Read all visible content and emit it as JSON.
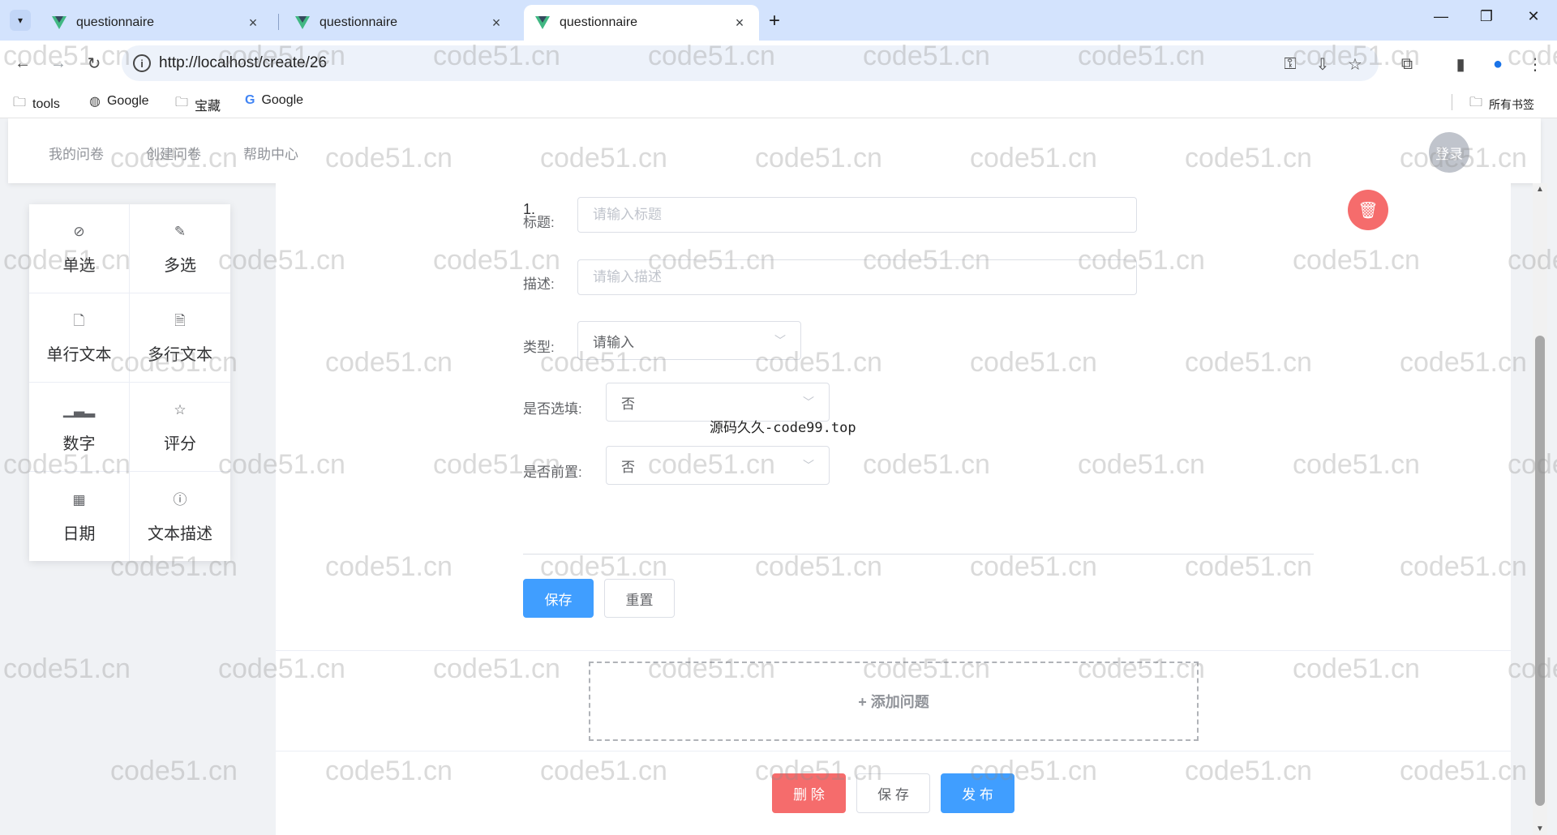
{
  "browser": {
    "tabs": [
      {
        "title": "questionnaire",
        "active": false
      },
      {
        "title": "questionnaire",
        "active": false
      },
      {
        "title": "questionnaire",
        "active": true
      }
    ],
    "new_tab_label": "+",
    "url": "http://localhost/create/26",
    "bookmarks": [
      {
        "label": "tools",
        "icon": "folder-icon"
      },
      {
        "label": "Google",
        "icon": "globe-icon"
      },
      {
        "label": "宝藏",
        "icon": "folder-icon"
      },
      {
        "label": "Google",
        "icon": "google-icon"
      }
    ],
    "all_bookmarks_label": "所有书签"
  },
  "app": {
    "nav": [
      "我的问卷",
      "创建问卷",
      "帮助中心"
    ],
    "login_label": "登录"
  },
  "palette": [
    {
      "label": "单选",
      "icon": "check-circle-icon"
    },
    {
      "label": "多选",
      "icon": "edit-icon"
    },
    {
      "label": "单行文本",
      "icon": "document-icon"
    },
    {
      "label": "多行文本",
      "icon": "document-lines-icon"
    },
    {
      "label": "数字",
      "icon": "bar-chart-icon"
    },
    {
      "label": "评分",
      "icon": "star-icon"
    },
    {
      "label": "日期",
      "icon": "calendar-icon"
    },
    {
      "label": "文本描述",
      "icon": "info-icon"
    }
  ],
  "question": {
    "number": "1.",
    "title_label": "标题:",
    "title_placeholder": "请输入标题",
    "desc_label": "描述:",
    "desc_placeholder": "请输入描述",
    "type_label": "类型:",
    "type_value": "请输入",
    "optional_label": "是否选填:",
    "optional_value": "否",
    "prefix_label": "是否前置:",
    "prefix_value": "否",
    "save_label": "保存",
    "reset_label": "重置"
  },
  "add_question_label": "+ 添加问题",
  "footer": {
    "delete_label": "删 除",
    "save_label": "保 存",
    "publish_label": "发 布"
  },
  "overlay_text": "源码久久-code99.top",
  "watermark_text": "code51.cn",
  "colors": {
    "primary": "#409eff",
    "danger": "#f56c6c",
    "tabstrip": "#d3e3fd"
  }
}
